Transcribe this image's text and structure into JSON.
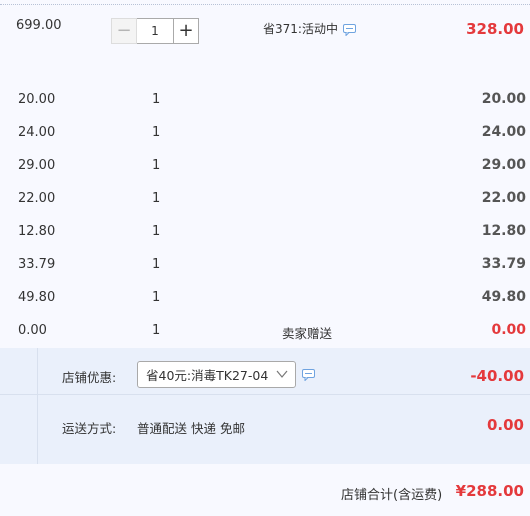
{
  "main_item": {
    "unit_price": "699.00",
    "quantity": "1",
    "minus_symbol": "−",
    "plus_symbol": "+",
    "promotion": "省371:活动中",
    "subtotal": "328.00"
  },
  "gift_items": [
    {
      "unit_price": "20.00",
      "quantity": "1",
      "note": "",
      "subtotal": "20.00"
    },
    {
      "unit_price": "24.00",
      "quantity": "1",
      "note": "",
      "subtotal": "24.00"
    },
    {
      "unit_price": "29.00",
      "quantity": "1",
      "note": "",
      "subtotal": "29.00"
    },
    {
      "unit_price": "22.00",
      "quantity": "1",
      "note": "",
      "subtotal": "22.00"
    },
    {
      "unit_price": "12.80",
      "quantity": "1",
      "note": "",
      "subtotal": "12.80"
    },
    {
      "unit_price": "33.79",
      "quantity": "1",
      "note": "",
      "subtotal": "33.79"
    },
    {
      "unit_price": "49.80",
      "quantity": "1",
      "note": "",
      "subtotal": "49.80"
    },
    {
      "unit_price": "0.00",
      "quantity": "1",
      "note": "卖家赠送",
      "subtotal": "0.00"
    }
  ],
  "shop": {
    "coupon_label": "店铺优惠:",
    "coupon_selected": "省40元:消毒TK27-04",
    "coupon_amount": "-40.00",
    "shipping_label": "运送方式:",
    "shipping_value": "普通配送 快递 免邮",
    "shipping_amount": "0.00"
  },
  "total": {
    "label": "店铺合计(含运费)",
    "amount": "¥288.00"
  },
  "colors": {
    "accent_red": "#e4393c",
    "panel_bg": "#eaf0fb",
    "page_bg": "#f8f9ff"
  },
  "icons": [
    "chat-bubble-icon",
    "chevron-down-icon"
  ]
}
